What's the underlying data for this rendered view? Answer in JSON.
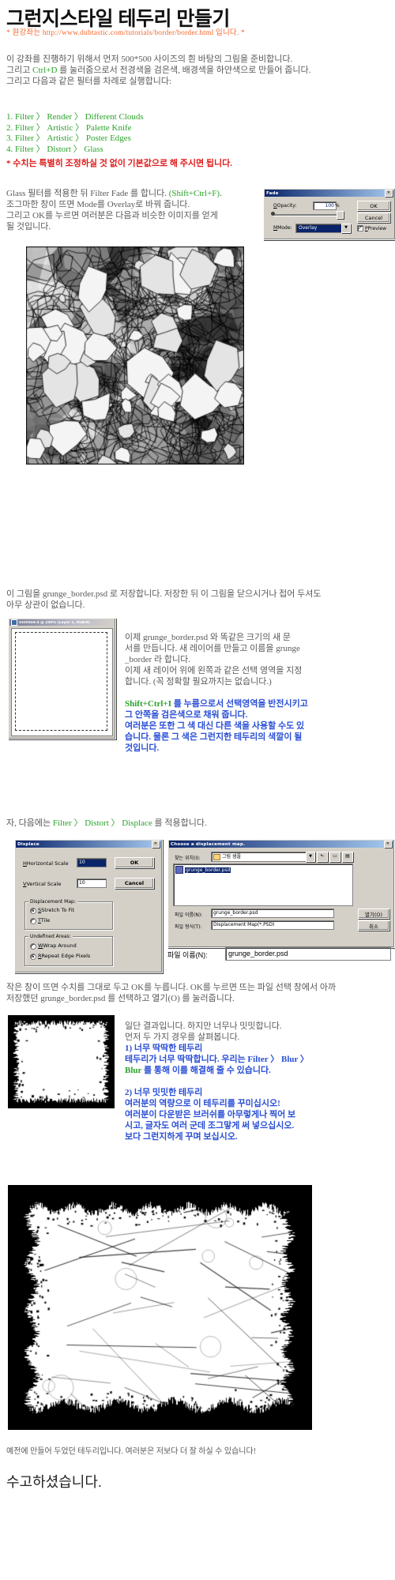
{
  "document": {
    "title": "그런지스타일 테두리 만들기",
    "source_note": "* 원강좌는 http://www.dubtastic.com/tutorials/border/border.html 입니다. *"
  },
  "intro": {
    "line1": "이 강좌를 진행하기 위해서 먼저 500*500 사이즈의 흰 바탕의 그림을 준비합니다.",
    "line2_a": "그리고 ",
    "line2_key": "Ctrl+D",
    "line2_b": " 를 눌러줌으로서 전경색을 검은색, 배경색을 하얀색으로 만들어 줍니다.",
    "line3": "그리고 다음과 같은 필터를 차례로 실행합니다:"
  },
  "steps": [
    "1. Filter 〉 Render 〉 Different Clouds",
    "2. Filter 〉 Artistic 〉 Palette Knife",
    "3. Filter 〉 Artistic 〉 Poster Edges",
    "4. Filter 〉 Distort 〉 Glass"
  ],
  "steps_note": "* 수치는 특별히 조정하실 것 없이 기본값으로 해 주시면 됩니다.",
  "fade_para": {
    "line1_a": "Glass 필터를 적용한 뒤 Filter Fade 를 합니다. ",
    "line1_key": "(Shift+Ctrl+F)",
    "line1_b": ".",
    "line2": "조그마한 창이 뜨면 Mode를 Overlay로 바꿔 줍니다.",
    "line3": "그리고 OK를 누르면 여러분은 다음과 비슷한 이미지를 얻게",
    "line4": "될 것입니다."
  },
  "fade_dialog": {
    "title": "Fade",
    "close_label": "✕",
    "opacity_label": "Opacity:",
    "opacity_value": "100",
    "percent_label": "%",
    "mode_label": "Mode:",
    "mode_value": "Overlay",
    "ok_label": "OK",
    "cancel_label": "Cancel",
    "preview_label": "Preview",
    "preview_checked": "✓"
  },
  "after_image_1": {
    "line1": "이 그림을 grunge_border.psd 로 저장합니다. 저장한 뒤 이 그림을 닫으시거나 접어 두셔도",
    "line2": "아무 상관이 없습니다."
  },
  "ps_window": {
    "title": "Untitled-4 @ 100% (Layer 1, RGB/8)"
  },
  "layer_para": {
    "l1": "이제 grunge_border.psd 와 똑같은 크기의 새 문",
    "l2": "서를 만듭니다. 새 레이어를 만들고 이름을 grunge",
    "l3": "_border 라 합니다.",
    "l4": "이제 새 레이어 위에 왼쪽과 같은 선택 영역을 지정",
    "l5": "합니다. (꼭 정확할 필요까지는 없습니다.)",
    "g1": "Shift+Ctrl+I",
    "g1_rest": " 를 누름으로서 선택영역을 반전시키고",
    "g2": "그 안쪽을 검은색으로 채워 줍니다.",
    "g3": "여러분은 또한 그 색 대신 다른 색을 사용할 수도 있",
    "g4": "습니다. 물론 그 색은 그런지한 테두리의 색깔이 될",
    "g5": "것입니다."
  },
  "displace_intro": {
    "a": "자, 다음에는 ",
    "key": "Filter 〉 Distort 〉 Displace",
    "b": " 를 적용합니다."
  },
  "displace_dialog": {
    "title": "Displace",
    "close_label": "✕",
    "horizontal_label": "Horizontal Scale",
    "horizontal_value": "10",
    "vertical_label": "Vertical Scale",
    "vertical_value": "10",
    "ok_label": "OK",
    "cancel_label": "Cancel",
    "map_group": "Displacement Map:",
    "map_opt1": "Stretch To Fit",
    "map_opt2": "Tile",
    "undef_group": "Undefined Areas:",
    "undef_opt1": "Wrap Around",
    "undef_opt2": "Repeat Edge Pixels"
  },
  "file_dialog": {
    "title": "Choose a displacement map.",
    "close_label": "✕",
    "lookin_label": "찾는 위치(I):",
    "lookin_value": "그림 샘플",
    "file_item": "grunge_border.psd",
    "filename_label": "파일 이름(N):",
    "filename_value": "grunge_border.psd",
    "filetype_label": "파일 형식(T):",
    "filetype_value": "Displacement Map(*.PSD)",
    "open_label": "열기(O)",
    "cancel_label": "취소",
    "big_filename_label": "파일 이름(N):",
    "big_filename_value": "grunge_border.psd"
  },
  "displace_after": {
    "l1": "작은 창이 뜨면 수치를 그대로 두고 OK를 누릅니다. OK를 누르면 뜨는 파일 선택 창에서 아까",
    "l2": "저장했던 grunge_border.psd 를 선택하고 열기(O) 를 눌러줍니다."
  },
  "result_para": {
    "l1": "일단 결과입니다. 하지만 너무나 밋밋합니다.",
    "l2": "먼저 두 가지 경우를 살펴봅니다.",
    "b1": "1) 너무 딱딱한 테두리",
    "b2": "테두리가 너무 딱딱합니다. 우리는 Filter 〉 Blur 〉",
    "b3_key": "Blur",
    "b3": " 를 통해 이를 해결해 줄 수 있습니다.",
    "c1": "2) 너무 밋밋한 테두리",
    "c2": "여러분의 역량으로 이 테두리를 꾸미십시오!",
    "c3": "여러분이 다운받은 브러쉬를 아무렇게나 찍어 보",
    "c4": "시고, 글자도 여러 군데 조그맣게 써 넣으십시오.",
    "c5": "보다 그런지하게 꾸며 보십시오."
  },
  "footer": {
    "caption": "예전에 만들어 두었던 테두리입니다. 여러분은 저보다 더 잘 하실 수 있습니다!",
    "signoff": "수고하셨습니다."
  },
  "colors": {
    "accent_orange": "#f4662a",
    "accent_green": "#2aa22a",
    "accent_red": "#e01b1b",
    "accent_blue": "#2a4fd6",
    "body_gray": "#595959",
    "dialog_face": "#d4d0c8",
    "title_bar": "#0a246a"
  }
}
